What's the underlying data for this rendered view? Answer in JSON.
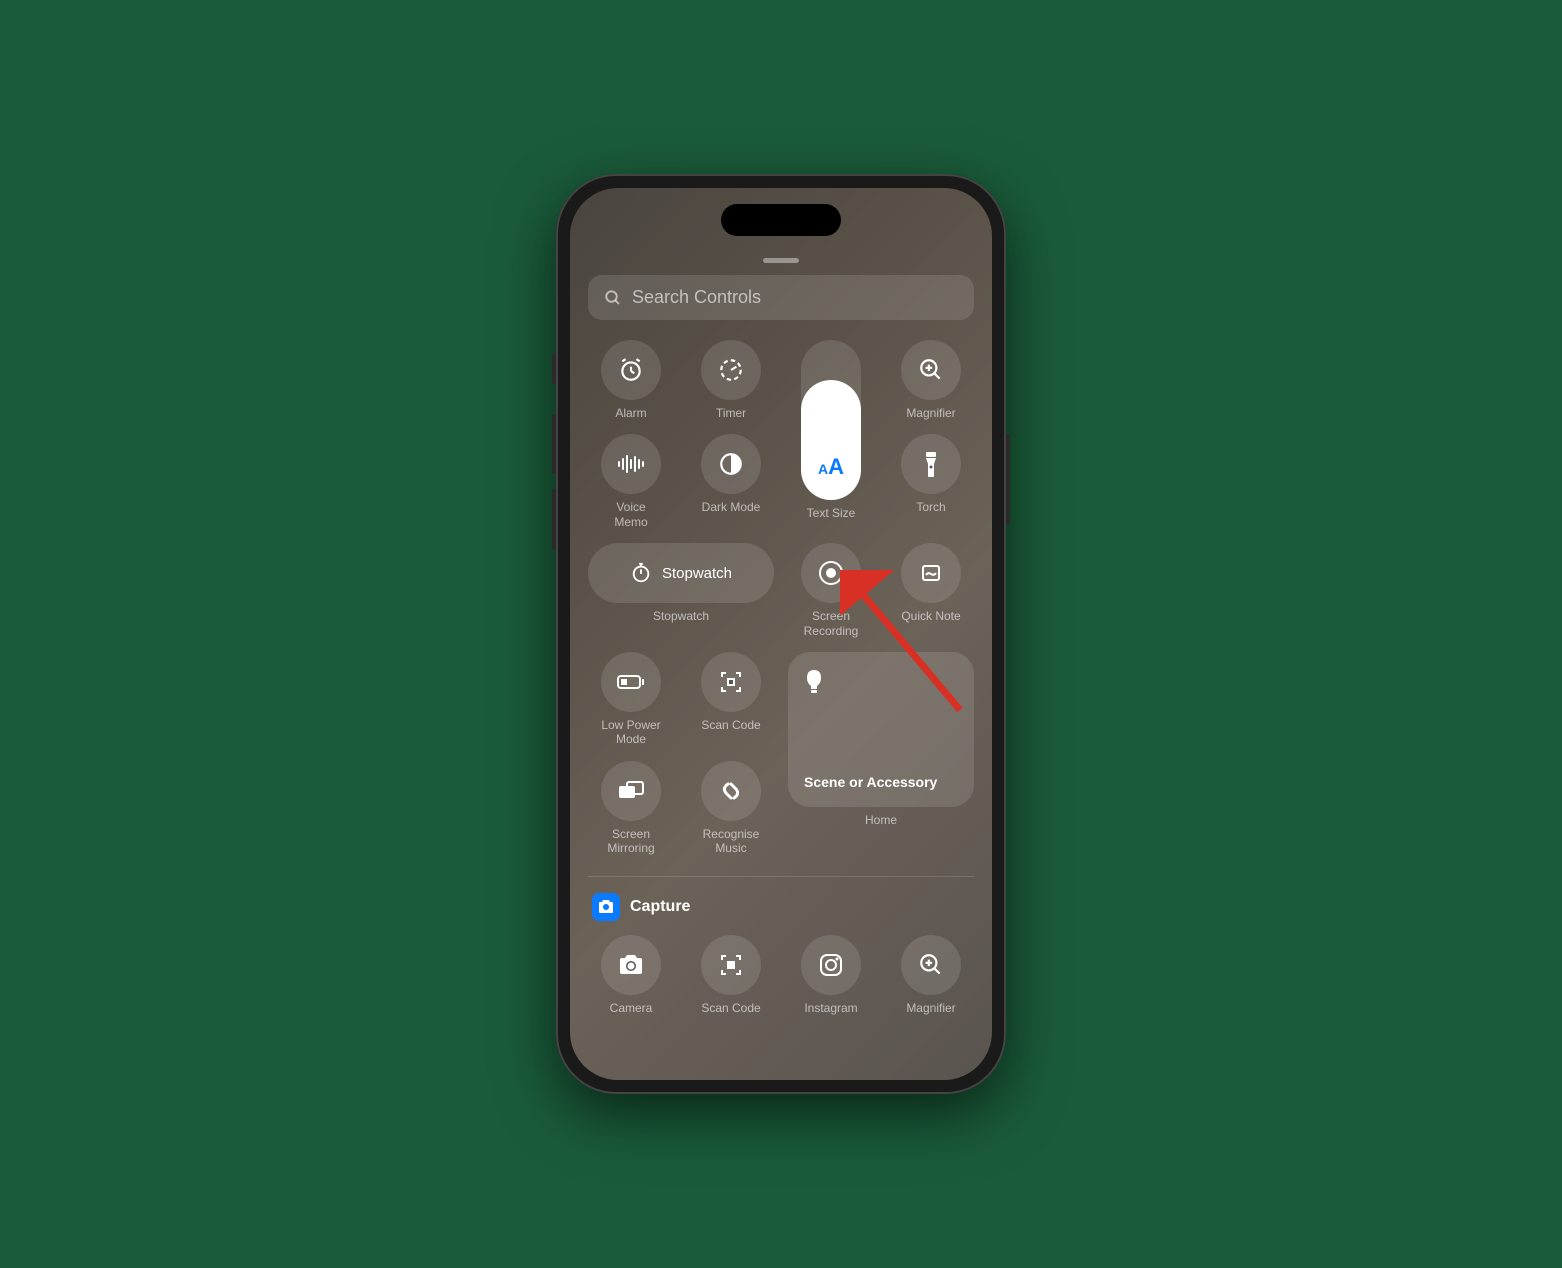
{
  "search": {
    "placeholder": "Search Controls"
  },
  "row1": {
    "alarm": "Alarm",
    "timer": "Timer",
    "magnifier": "Magnifier"
  },
  "row2": {
    "voice_memo": "Voice\nMemo",
    "dark_mode": "Dark Mode",
    "text_size": "Text Size",
    "torch": "Torch"
  },
  "stopwatch": {
    "inner": "Stopwatch",
    "label": "Stopwatch"
  },
  "row3": {
    "screen_recording": "Screen\nRecording",
    "quick_note": "Quick Note"
  },
  "row4": {
    "low_power": "Low Power\nMode",
    "scan_code": "Scan Code"
  },
  "home": {
    "top_label": "Scene or Accessory",
    "label": "Home"
  },
  "row5": {
    "screen_mirroring": "Screen\nMirroring",
    "recognise_music": "Recognise\nMusic"
  },
  "capture_section": {
    "title": "Capture",
    "items": {
      "camera": "Camera",
      "scan_code": "Scan Code",
      "instagram": "Instagram",
      "magnifier": "Magnifier"
    }
  }
}
